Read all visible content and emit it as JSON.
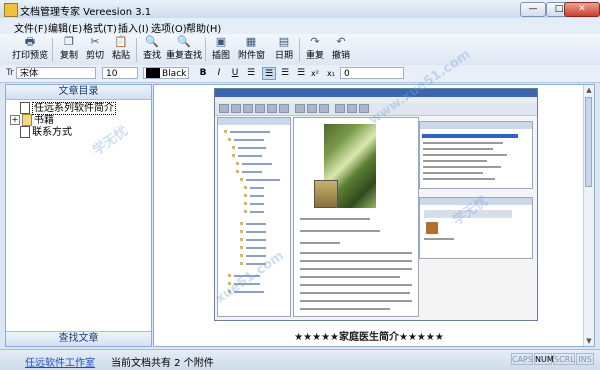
{
  "window": {
    "title": "文档管理专家 Vereesion 3.1",
    "min": "—",
    "max": "□",
    "close": "✕"
  },
  "menu": [
    "文件(F)",
    "编辑(E)",
    "格式(T)",
    "插入(I)",
    "选项(O)",
    "帮助(H)"
  ],
  "toolbar": [
    {
      "label": "打印预览",
      "icon": "print-preview-icon",
      "glyph": "🖶"
    },
    {
      "label": "复制",
      "icon": "copy-icon",
      "glyph": "❐"
    },
    {
      "label": "剪切",
      "icon": "cut-icon",
      "glyph": "✂"
    },
    {
      "label": "粘贴",
      "icon": "paste-icon",
      "glyph": "📋"
    },
    {
      "label": "查找",
      "icon": "find-icon",
      "glyph": "🔍"
    },
    {
      "label": "重复查找",
      "icon": "find-again-icon",
      "glyph": "🔍"
    },
    {
      "label": "插图",
      "icon": "insert-picture-icon",
      "glyph": "▣"
    },
    {
      "label": "附件窗",
      "icon": "attachment-window-icon",
      "glyph": "▦"
    },
    {
      "label": "日期",
      "icon": "date-icon",
      "glyph": "▤"
    },
    {
      "label": "重复",
      "icon": "redo-icon",
      "glyph": "↷"
    },
    {
      "label": "撤销",
      "icon": "undo-icon",
      "glyph": "↶"
    }
  ],
  "format": {
    "font_prefix": "Tr",
    "font": "宋体",
    "size": "10",
    "color_name": "Black",
    "color_hex": "#000000",
    "bold": "B",
    "italic": "I",
    "underline": "U",
    "strike": "☰",
    "superscript": "x²",
    "subscript": "x₁",
    "indent": "0"
  },
  "left_panel": {
    "header": "文章目录",
    "footer": "查找文章",
    "tree": [
      {
        "label": "任远系列软件简介",
        "type": "doc",
        "selected": true
      },
      {
        "label": "书籍",
        "type": "folder",
        "expander": "+"
      },
      {
        "label": "联系方式",
        "type": "doc",
        "selected": false
      }
    ]
  },
  "main": {
    "caption": "★★★★★家庭医生简介★★★★★"
  },
  "status": {
    "link": "任远软件工作室",
    "info": "当前文档共有 2 个附件",
    "indicators": [
      {
        "label": "CAPS",
        "on": false
      },
      {
        "label": "NUM",
        "on": true
      },
      {
        "label": "SCRL",
        "on": false
      },
      {
        "label": "INS",
        "on": false
      }
    ]
  }
}
